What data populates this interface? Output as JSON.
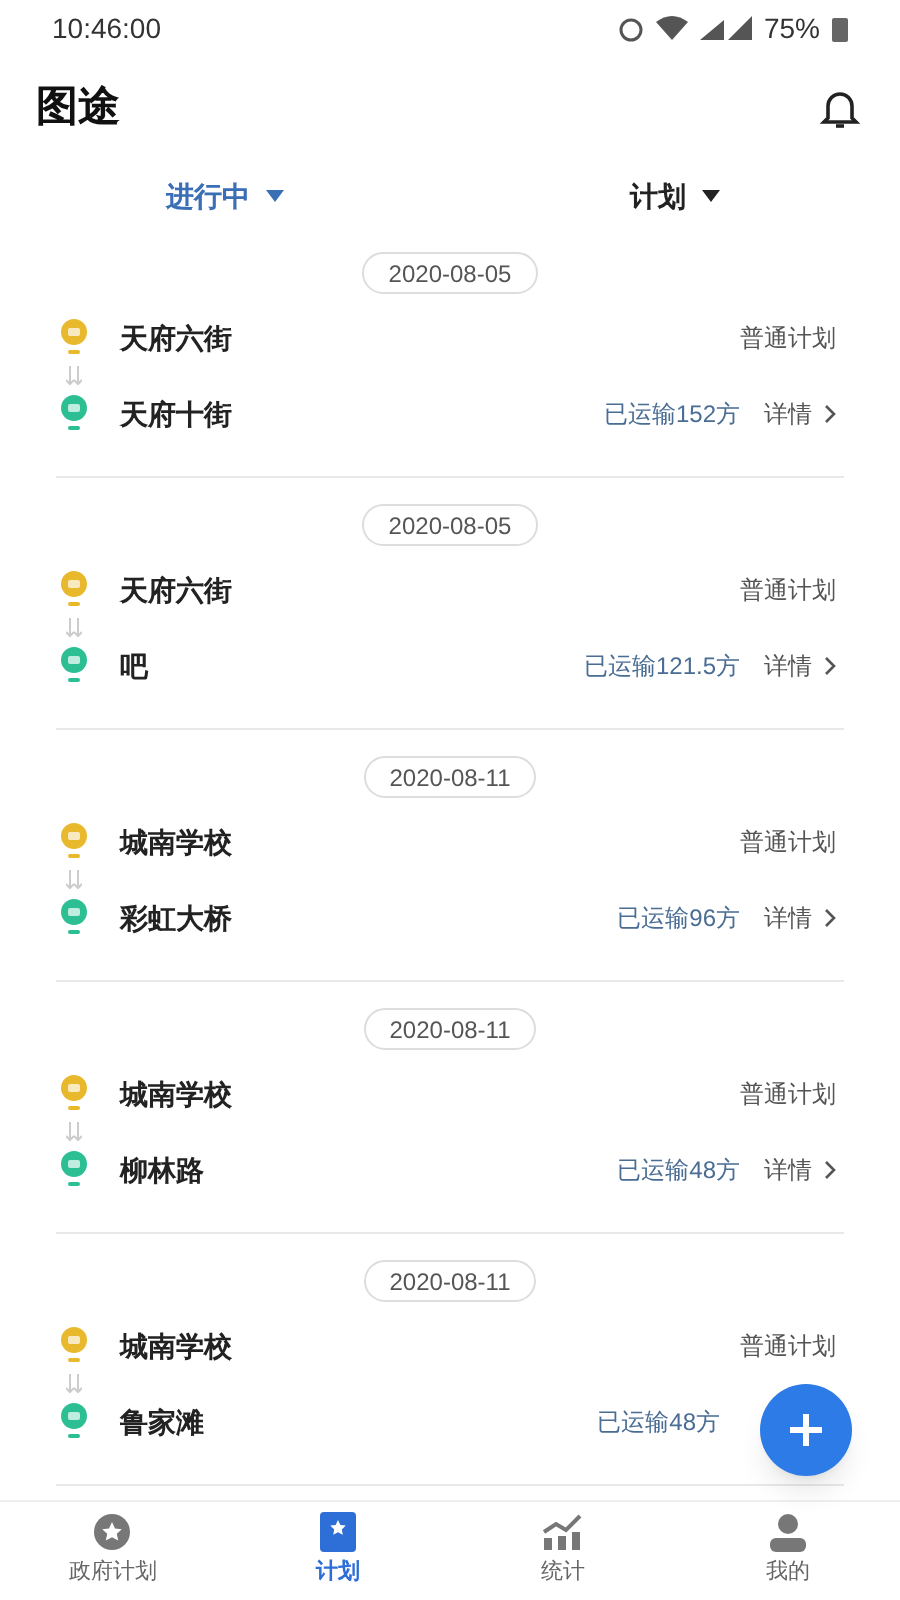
{
  "status_bar": {
    "time": "10:46:00",
    "battery": "75%"
  },
  "header": {
    "title": "图途"
  },
  "filters": [
    {
      "label": "进行中",
      "selected": true
    },
    {
      "label": "计划",
      "selected": false
    }
  ],
  "plans": [
    {
      "date": "2020-08-05",
      "from": "天府六街",
      "to": "天府十街",
      "type": "普通计划",
      "shipped": "已运输152方",
      "detail": "详情"
    },
    {
      "date": "2020-08-05",
      "from": "天府六街",
      "to": "吧",
      "type": "普通计划",
      "shipped": "已运输121.5方",
      "detail": "详情"
    },
    {
      "date": "2020-08-11",
      "from": "城南学校",
      "to": "彩虹大桥",
      "type": "普通计划",
      "shipped": "已运输96方",
      "detail": "详情"
    },
    {
      "date": "2020-08-11",
      "from": "城南学校",
      "to": "柳林路",
      "type": "普通计划",
      "shipped": "已运输48方",
      "detail": "详情"
    },
    {
      "date": "2020-08-11",
      "from": "城南学校",
      "to": "鲁家滩",
      "type": "普通计划",
      "shipped": "已运输48方"
    }
  ],
  "bottom_nav": [
    {
      "kind": "gov",
      "label": "政府计划",
      "selected": false
    },
    {
      "kind": "plan",
      "label": "计划",
      "selected": true
    },
    {
      "kind": "stats",
      "label": "统计",
      "selected": false
    },
    {
      "kind": "me",
      "label": "我的",
      "selected": false
    }
  ]
}
